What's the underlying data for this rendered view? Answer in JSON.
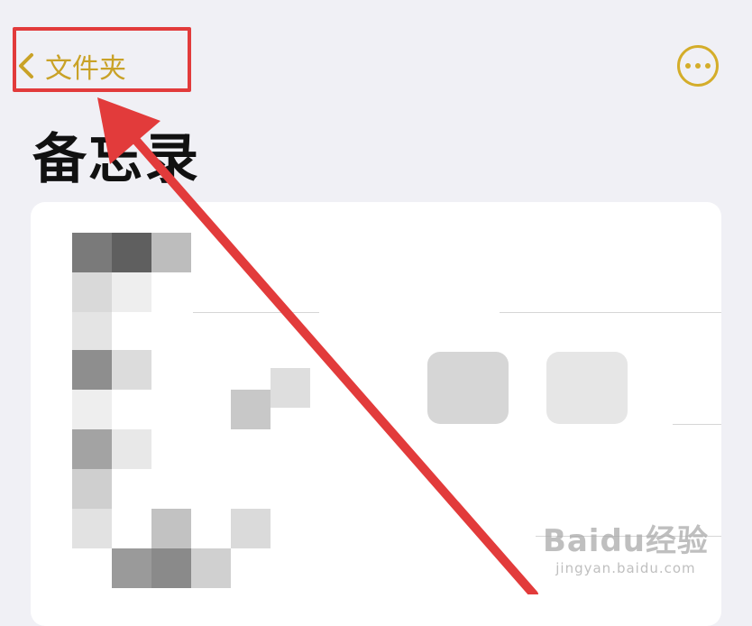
{
  "nav": {
    "back_label": "文件夹"
  },
  "page": {
    "title": "备忘录"
  },
  "menu": {
    "icon": "ellipsis-circle-icon"
  },
  "watermark": {
    "brand": "Baidu经验",
    "url": "jingyan.baidu.com"
  },
  "colors": {
    "accent": "#c9a227",
    "annotation": "#e23b3b",
    "background": "#f0f0f5"
  }
}
